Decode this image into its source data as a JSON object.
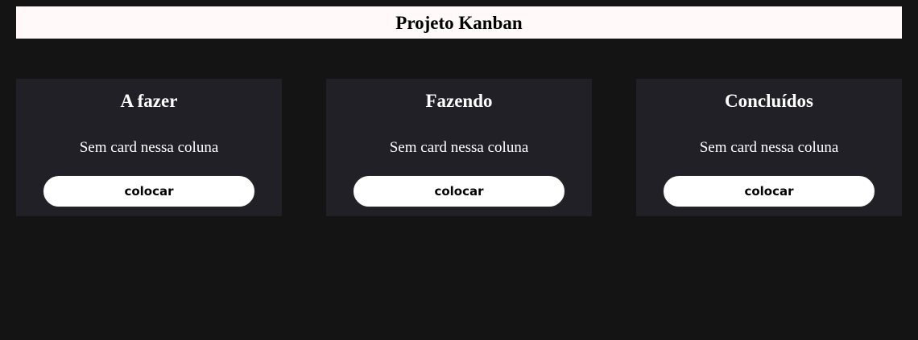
{
  "header": {
    "title": "Projeto Kanban"
  },
  "columns": [
    {
      "title": "A fazer",
      "empty_text": "Sem card nessa coluna",
      "button_label": "colocar"
    },
    {
      "title": "Fazendo",
      "empty_text": "Sem card nessa coluna",
      "button_label": "colocar"
    },
    {
      "title": "Concluídos",
      "empty_text": "Sem card nessa coluna",
      "button_label": "colocar"
    }
  ],
  "colors": {
    "page_background": "#141414",
    "header_background": "#fffaf9",
    "column_background": "#212027",
    "button_background": "#ffffff"
  }
}
